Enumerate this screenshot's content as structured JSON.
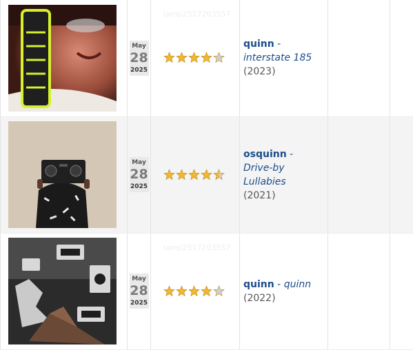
{
  "entries": [
    {
      "month": "May",
      "day": "28",
      "year": "2025",
      "rating": 4,
      "ghost_text": "lamp2517203557",
      "artist": "quinn",
      "separator": " - ",
      "title": "interstate 185",
      "release_year": "(2023)",
      "cover_icon": "album-cover-fist-photo"
    },
    {
      "month": "May",
      "day": "28",
      "year": "2025",
      "rating": 4.5,
      "ghost_text": "",
      "artist": "osquinn",
      "separator": " - ",
      "title": "Drive-by Lullabies",
      "release_year": "(2021)",
      "cover_icon": "album-cover-turntable-photo"
    },
    {
      "month": "May",
      "day": "28",
      "year": "2025",
      "rating": 4,
      "ghost_text": "lamp2517203557",
      "artist": "quinn",
      "separator": " - ",
      "title": "quinn",
      "release_year": "(2022)",
      "cover_icon": "album-cover-synth-gear-photo"
    }
  ],
  "colors": {
    "star_fill": "#f2b632",
    "star_empty": "#cfcfcf",
    "link": "#1c4c8c"
  }
}
